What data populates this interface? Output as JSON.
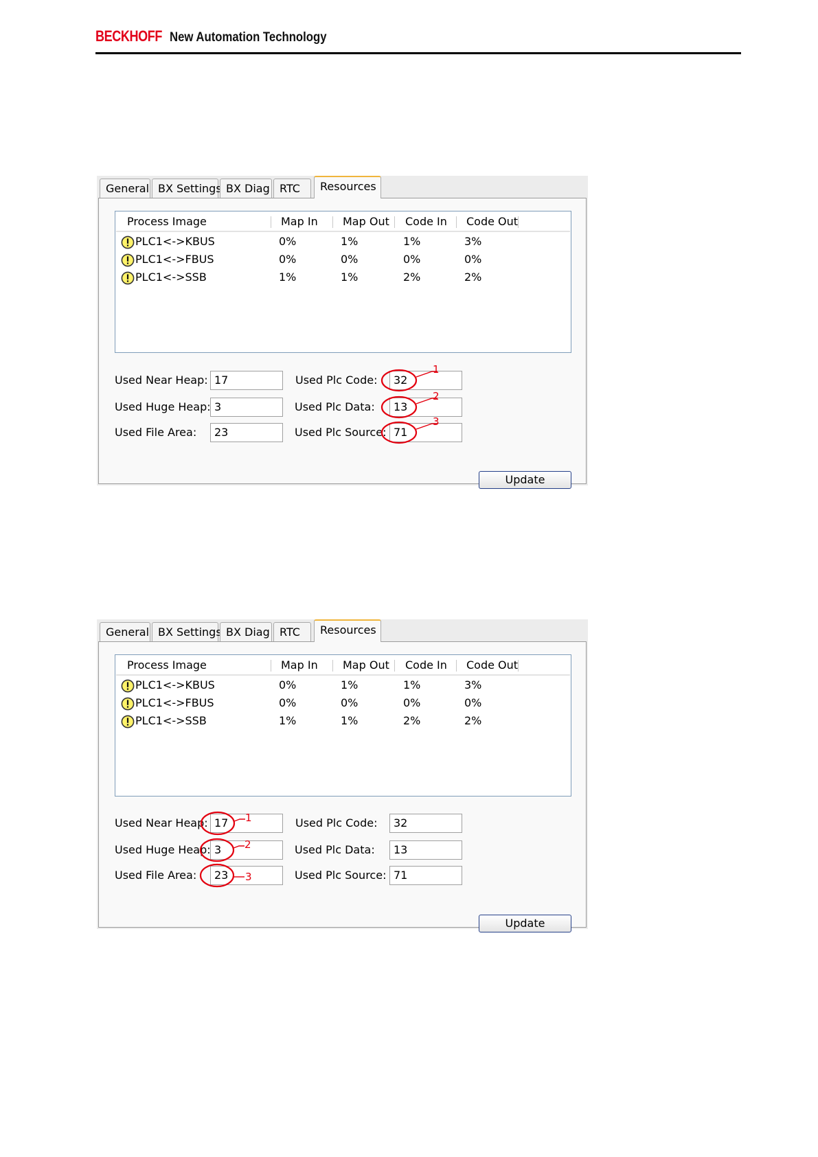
{
  "header": {
    "brand": "BECKHOFF",
    "tagline": "New Automation Technology"
  },
  "dialog": {
    "tabs": [
      "General",
      "BX Settings",
      "BX Diag",
      "RTC",
      "Resources"
    ],
    "active_tab": "Resources",
    "list_columns": [
      "Process Image",
      "Map In",
      "Map Out",
      "Code In",
      "Code Out"
    ],
    "rows": [
      {
        "name": "PLC1<->KBUS",
        "map_in": "0%",
        "map_out": "1%",
        "code_in": "1%",
        "code_out": "3%"
      },
      {
        "name": "PLC1<->FBUS",
        "map_in": "0%",
        "map_out": "0%",
        "code_in": "0%",
        "code_out": "0%"
      },
      {
        "name": "PLC1<->SSB",
        "map_in": "1%",
        "map_out": "1%",
        "code_in": "2%",
        "code_out": "2%"
      }
    ],
    "fields": {
      "near_heap_label": "Used Near Heap:",
      "near_heap_value": "17",
      "huge_heap_label": "Used Huge Heap:",
      "huge_heap_value": "3",
      "file_area_label": "Used File Area:",
      "file_area_value": "23",
      "plc_code_label": "Used Plc Code:",
      "plc_code_value": "32",
      "plc_data_label": "Used Plc Data:",
      "plc_data_value": "13",
      "plc_source_label": "Used Plc Source:",
      "plc_source_value": "71"
    },
    "update_label": "Update",
    "warning_icon": "warning-icon"
  },
  "annotations": {
    "markers": [
      "1",
      "2",
      "3"
    ],
    "color": "#e3000f",
    "figure1_target": "Used Plc Code / Used Plc Data / Used Plc Source",
    "figure2_target": "Used Near Heap / Used Huge Heap / Used File Area"
  }
}
